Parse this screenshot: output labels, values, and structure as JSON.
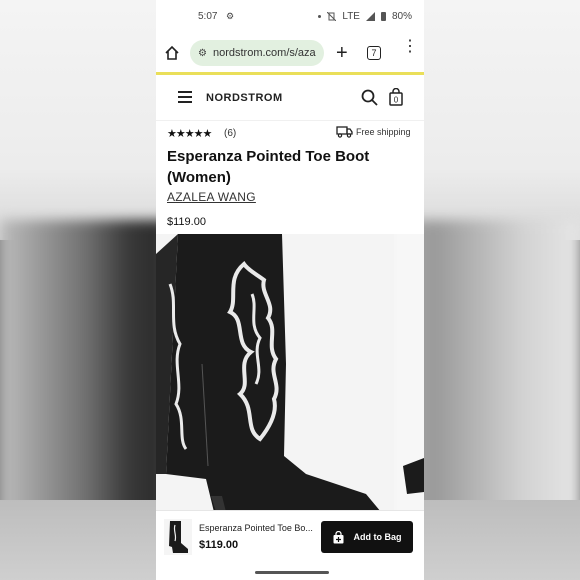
{
  "status_bar": {
    "time": "5:07",
    "network": "LTE",
    "battery": "80%"
  },
  "browser": {
    "url": "nordstrom.com/s/aza",
    "tab_count": "7"
  },
  "site": {
    "logo": "NORDSTROM"
  },
  "product": {
    "rating_stars": "★★★★★",
    "review_count": "(6)",
    "shipping": "Free shipping",
    "title": "Esperanza Pointed Toe Boot (Women)",
    "brand": "AZALEA WANG",
    "price": "$119.00"
  },
  "sticky_bar": {
    "title": "Esperanza Pointed Toe Bo...",
    "price": "$119.00",
    "add_button": "Add to Bag"
  },
  "colors": {
    "accent_line": "#eadf59",
    "url_bg": "#e2f0e0",
    "button_bg": "#111111"
  }
}
